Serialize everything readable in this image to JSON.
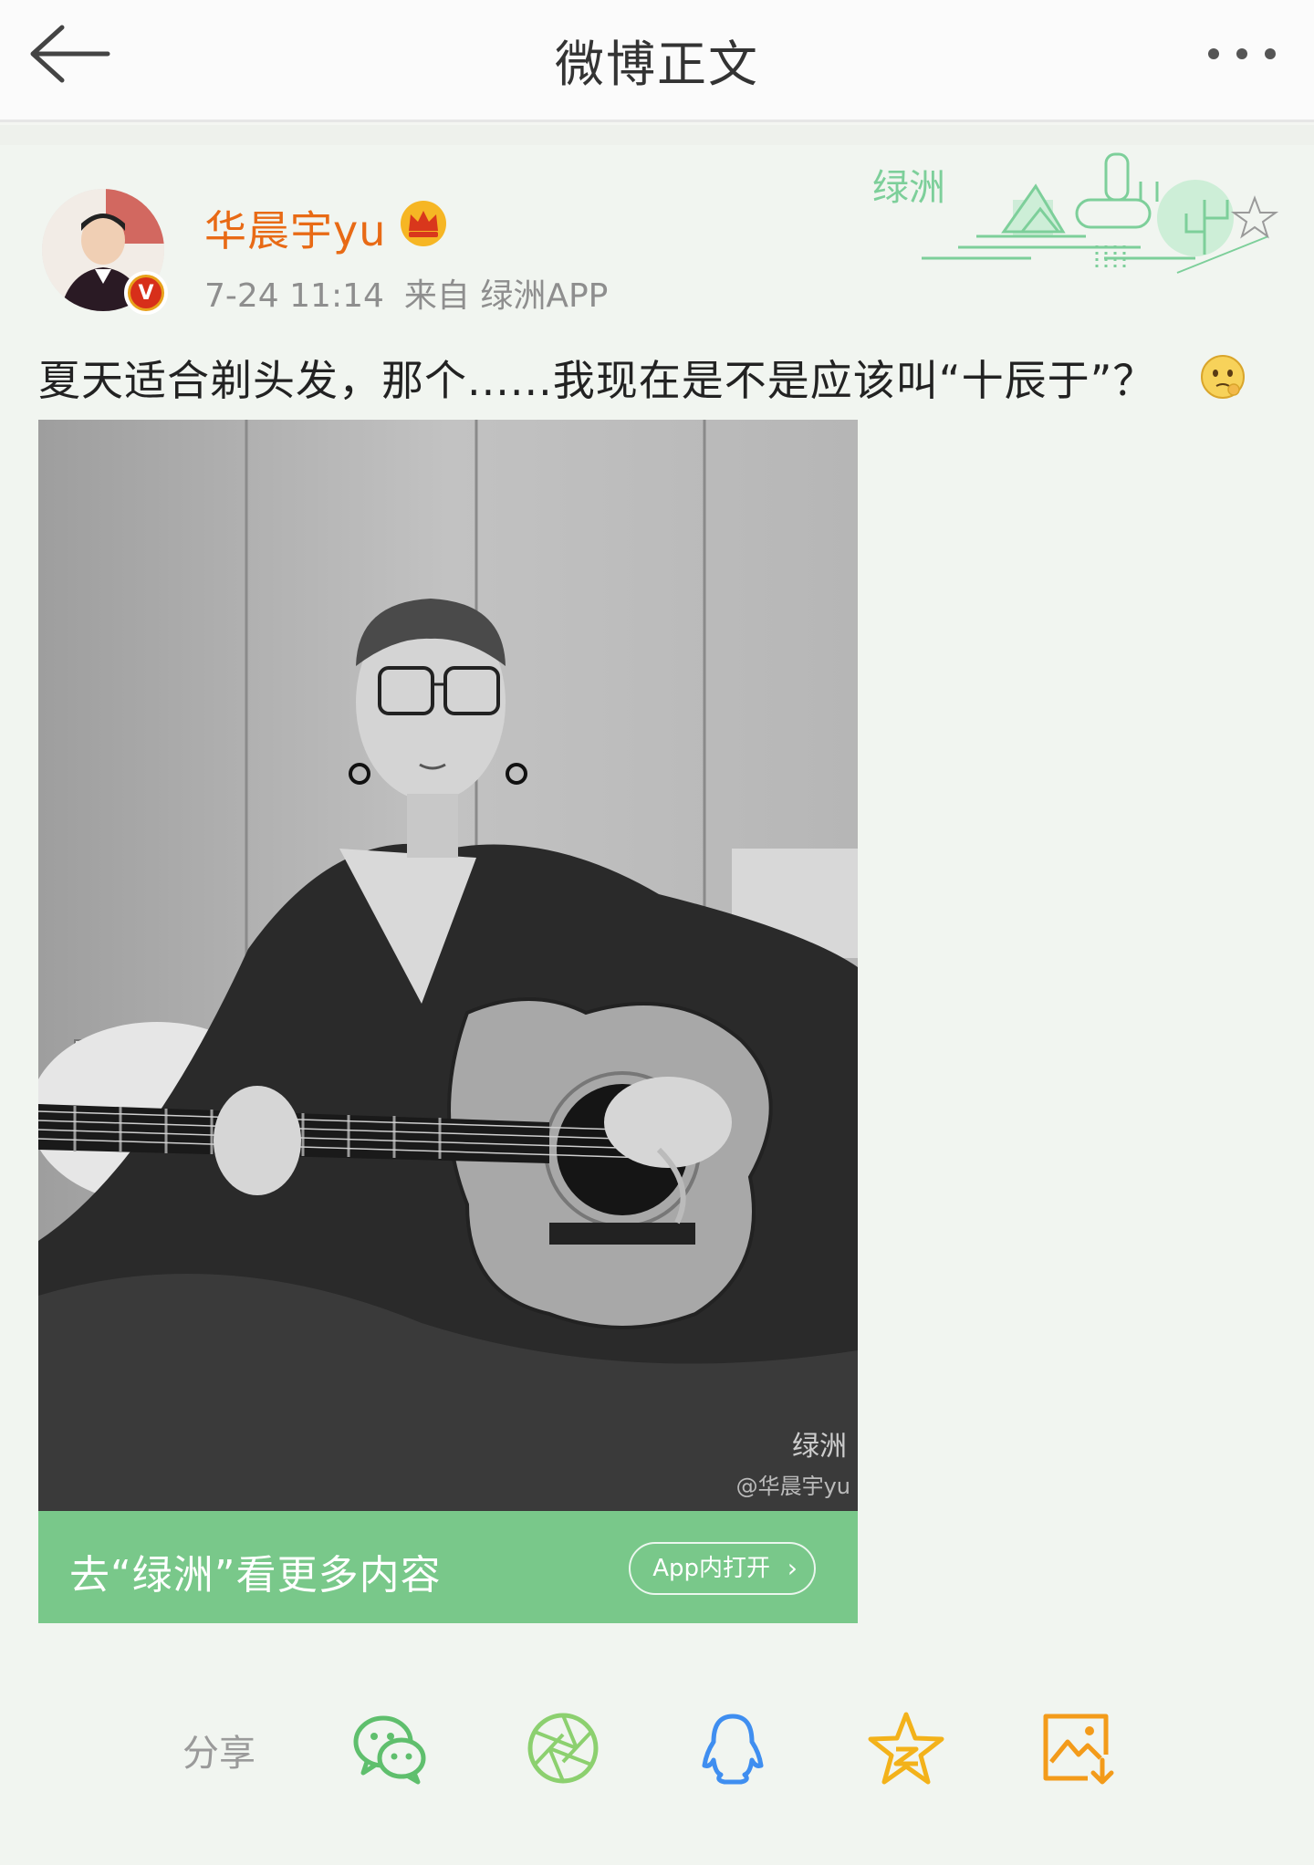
{
  "header": {
    "title": "微博正文"
  },
  "post": {
    "username": "华晨宇yu",
    "timestamp": "7-24 11:14",
    "source": "来自 绿洲APP",
    "text": "夏天适合剃头发，那个......我现在是不是应该叫“十辰于”？",
    "deco_brand": "绿洲",
    "image_watermark_brand": "绿洲",
    "image_watermark_user": "@华晨宇yu"
  },
  "cta": {
    "text": "去“绿洲”看更多内容",
    "button_label": "App内打开"
  },
  "share": {
    "label": "分享",
    "targets": [
      "wechat-icon",
      "moments-icon",
      "qq-icon",
      "qzone-icon",
      "save-image-icon"
    ]
  },
  "colors": {
    "username": "#e86a15",
    "cta_bg": "#79c88a",
    "accent_green": "#5fbf6d",
    "qq_blue": "#3f8ef0",
    "qzone_yellow": "#f3b21a",
    "save_orange": "#f39b1a"
  }
}
